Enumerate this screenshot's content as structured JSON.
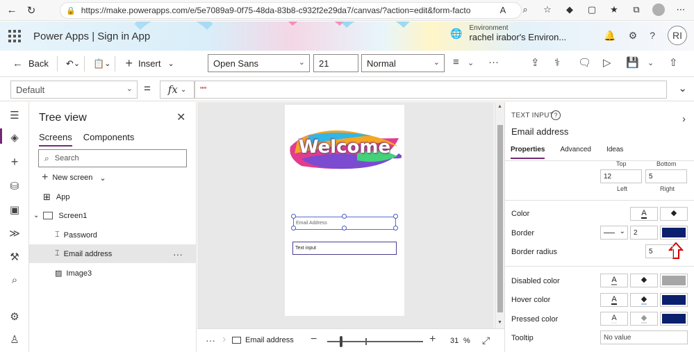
{
  "browser": {
    "url": "https://make.powerapps.com/e/5e7089a9-0f75-48da-83b8-c932f2e29da7/canvas/?action=edit&form-factor=..."
  },
  "header": {
    "app_title": "Power Apps  |  Sign in App",
    "env_label": "Environment",
    "env_name": "rachel irabor's Environ...",
    "user_initials": "RI"
  },
  "commandbar": {
    "back": "Back",
    "insert": "Insert",
    "font": "Open Sans",
    "size": "21",
    "weight": "Normal",
    "more": "···"
  },
  "formula": {
    "property": "Default",
    "equals": "=",
    "fx": "fx",
    "value": "\"\""
  },
  "tree": {
    "title": "Tree view",
    "tab_screens": "Screens",
    "tab_components": "Components",
    "search_placeholder": "Search",
    "new_screen": "New screen",
    "items": [
      {
        "label": "App"
      },
      {
        "label": "Screen1"
      },
      {
        "label": "Password"
      },
      {
        "label": "Email address"
      },
      {
        "label": "Image3"
      }
    ],
    "more": "···"
  },
  "canvas": {
    "welcome": "Welcome",
    "email_placeholder": "Email Address",
    "text_input": "Text input"
  },
  "statusbar": {
    "more": "···",
    "breadcrumb": "Email address",
    "zoom_percent": 31,
    "zoom_value": "31",
    "zoom_unit": "%"
  },
  "props": {
    "control_type": "TEXT INPUT",
    "control_name": "Email address",
    "tabs": [
      "Properties",
      "Advanced",
      "Ideas"
    ],
    "padding": {
      "top_label": "Top",
      "bottom_label": "Bottom",
      "left_label": "Left",
      "right_label": "Right",
      "left_value": "12",
      "right_value": "5"
    },
    "rows": {
      "color": "Color",
      "border": "Border",
      "border_width": "2",
      "border_radius": "Border radius",
      "border_radius_value": "5",
      "disabled_color": "Disabled color",
      "hover_color": "Hover color",
      "pressed_color": "Pressed color",
      "tooltip": "Tooltip",
      "tooltip_value": "No value"
    },
    "colors": {
      "border": "#0a1f6e",
      "disabled": "#a6a6a6",
      "hover": "#0a1f6e",
      "pressed": "#0a1f6e",
      "accent": "#742774"
    }
  }
}
